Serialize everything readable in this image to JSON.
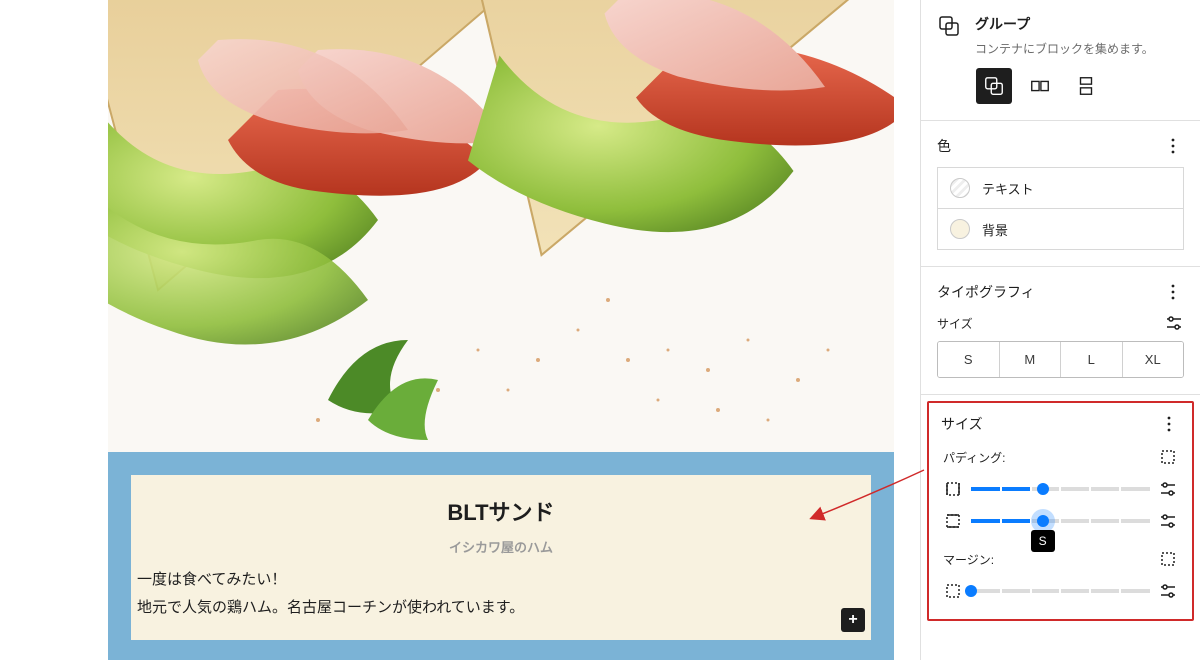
{
  "block": {
    "title": "グループ",
    "desc": "コンテナにブロックを集めます。",
    "variations": [
      "group",
      "row",
      "stack"
    ]
  },
  "color_section": {
    "heading": "色",
    "items": [
      {
        "label": "テキスト",
        "swatch": "striped"
      },
      {
        "label": "背景",
        "swatch": "bg"
      }
    ]
  },
  "typography_section": {
    "heading": "タイポグラフィ",
    "size_label": "サイズ",
    "sizes": [
      "S",
      "M",
      "L",
      "XL"
    ]
  },
  "size_section": {
    "heading": "サイズ",
    "padding_label": "パディング:",
    "margin_label": "マージン:",
    "padding_sliders": [
      {
        "value_pct": 40,
        "value_label": null,
        "halo": false
      },
      {
        "value_pct": 40,
        "value_label": "S",
        "halo": true
      }
    ],
    "margin_sliders": [
      {
        "value_pct": 0,
        "value_label": null,
        "halo": false,
        "thumb": "blue"
      }
    ],
    "track_segments": 6
  },
  "card": {
    "title": "BLTサンド",
    "subtitle": "イシカワ屋のハム",
    "body_line1": "一度は食べてみたい！",
    "body_line2": "地元で人気の鶏ハム。名古屋コーチンが使われています。"
  },
  "colors": {
    "brand_blue": "#0a7cff",
    "frame_blue": "#7bb3d6",
    "cream": "#f8f2e0",
    "highlight_red": "#d02a2a"
  }
}
